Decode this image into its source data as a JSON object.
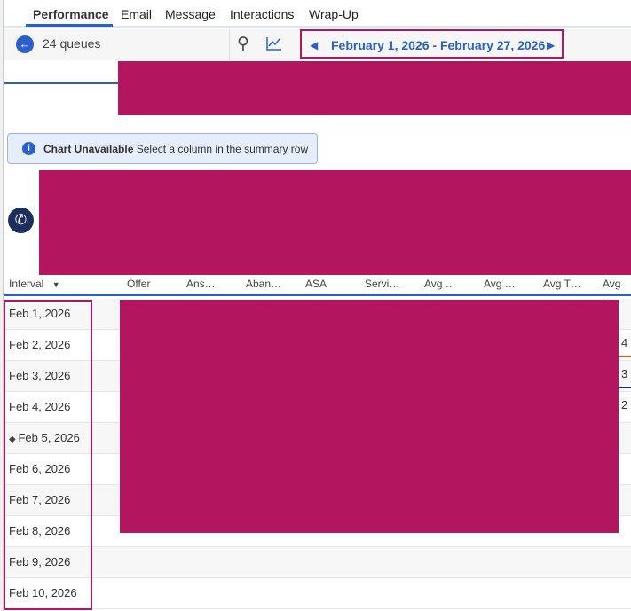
{
  "tabs": [
    "Performance",
    "Email",
    "Message",
    "Interactions",
    "Wrap-Up"
  ],
  "toolbar": {
    "queues": "24 queues",
    "date_range": "February 1, 2026 - February 27, 2026"
  },
  "notice": {
    "title": "Chart Unavailable",
    "text": "Select a column in the summary row"
  },
  "table": {
    "columns": [
      "Interval",
      "Offer",
      "Ans…",
      "Aban…",
      "ASA",
      "Servi…",
      "Avg …",
      "Avg …",
      "Avg T…",
      "Avg …"
    ],
    "rows": [
      "Feb 1, 2026",
      "Feb 2, 2026",
      "Feb 3, 2026",
      "Feb 4, 2026",
      "Feb 5, 2026",
      "Feb 6, 2026",
      "Feb 7, 2026",
      "Feb 8, 2026",
      "Feb 9, 2026",
      "Feb 10, 2026"
    ],
    "edge_fragments": [
      "4",
      "3",
      "2"
    ]
  },
  "colors": {
    "accent": "#2a60c8",
    "redaction": "#b3165f"
  }
}
